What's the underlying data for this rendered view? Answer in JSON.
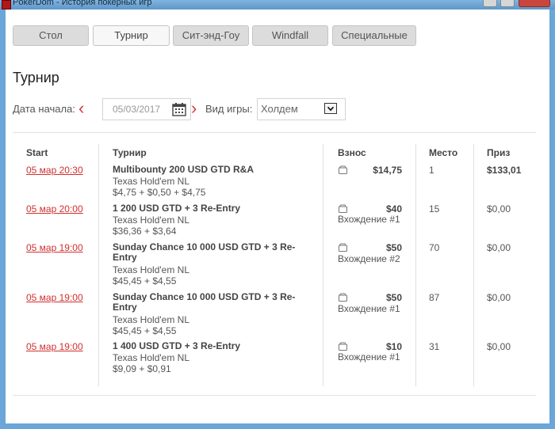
{
  "window": {
    "title": "PokerDom - История покерных игр"
  },
  "tabs": [
    {
      "label": "Стол",
      "active": false
    },
    {
      "label": "Турнир",
      "active": true
    },
    {
      "label": "Сит-энд-Гоу",
      "active": false
    },
    {
      "label": "Windfall",
      "active": false
    },
    {
      "label": "Специальные",
      "active": false
    }
  ],
  "page": {
    "title": "Турнир"
  },
  "filters": {
    "date_label": "Дата начала:",
    "date_value": "05/03/2017",
    "game_label": "Вид игры:",
    "game_value": "Холдем"
  },
  "table": {
    "headers": {
      "start": "Start",
      "tournament": "Турнир",
      "fee": "Взнос",
      "place": "Место",
      "prize": "Приз"
    },
    "rows": [
      {
        "start": "05 мар 20:30",
        "name": "Multibounty 200 USD GTD R&A",
        "game": "Texas Hold'em NL",
        "buyin": "$4,75 + $0,50 + $4,75",
        "fee": "$14,75",
        "entry": "",
        "place": "1",
        "prize": "$133,01"
      },
      {
        "start": "05 мар 20:00",
        "name": "1 200 USD GTD + 3 Re-Entry",
        "game": "Texas Hold'em NL",
        "buyin": "$36,36 + $3,64",
        "fee": "$40",
        "entry": "Вхождение #1",
        "place": "15",
        "prize": "$0,00"
      },
      {
        "start": "05 мар 19:00",
        "name": "Sunday Chance 10 000 USD GTD + 3 Re-Entry",
        "game": "Texas Hold'em NL",
        "buyin": "$45,45 + $4,55",
        "fee": "$50",
        "entry": "Вхождение #2",
        "place": "70",
        "prize": "$0,00"
      },
      {
        "start": "05 мар 19:00",
        "name": "Sunday Chance 10 000 USD GTD + 3 Re-Entry",
        "game": "Texas Hold'em NL",
        "buyin": "$45,45 + $4,55",
        "fee": "$50",
        "entry": "Вхождение #1",
        "place": "87",
        "prize": "$0,00"
      },
      {
        "start": "05 мар 19:00",
        "name": "1 400 USD GTD + 3 Re-Entry",
        "game": "Texas Hold'em NL",
        "buyin": "$9,09 + $0,91",
        "fee": "$10",
        "entry": "Вхождение #1",
        "place": "31",
        "prize": "$0,00"
      }
    ]
  },
  "icons": {
    "calendar": "calendar-icon",
    "prev": "chevron-left-icon",
    "next": "chevron-right-icon",
    "dropdown": "dropdown-arrow-icon",
    "fee": "wallet-icon"
  },
  "colors": {
    "accent": "#d03030",
    "window_frame": "#6aa6d8"
  }
}
